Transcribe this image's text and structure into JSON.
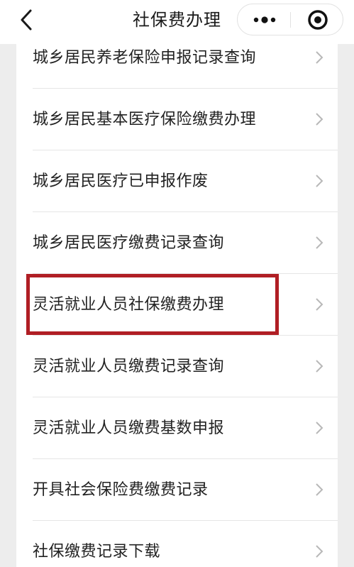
{
  "header": {
    "title": "社保费办理",
    "back_icon": "chevron-left-icon",
    "more_icon": "more-dots-icon",
    "close_icon": "target-circle-icon"
  },
  "list": {
    "items": [
      {
        "label": "城乡居民养老保险申报记录查询"
      },
      {
        "label": "城乡居民基本医疗保险缴费办理"
      },
      {
        "label": "城乡居民医疗已申报作废"
      },
      {
        "label": "城乡居民医疗缴费记录查询"
      },
      {
        "label": "灵活就业人员社保缴费办理",
        "highlighted": true
      },
      {
        "label": "灵活就业人员缴费记录查询"
      },
      {
        "label": "灵活就业人员缴费基数申报"
      },
      {
        "label": "开具社会保险费缴费记录"
      },
      {
        "label": "社保缴费记录下载"
      }
    ],
    "chevron_icon": "chevron-right-icon"
  },
  "colors": {
    "highlight_border": "#b01e24",
    "background": "#ededed",
    "card": "#ffffff",
    "chevron": "#b8b8b8"
  }
}
